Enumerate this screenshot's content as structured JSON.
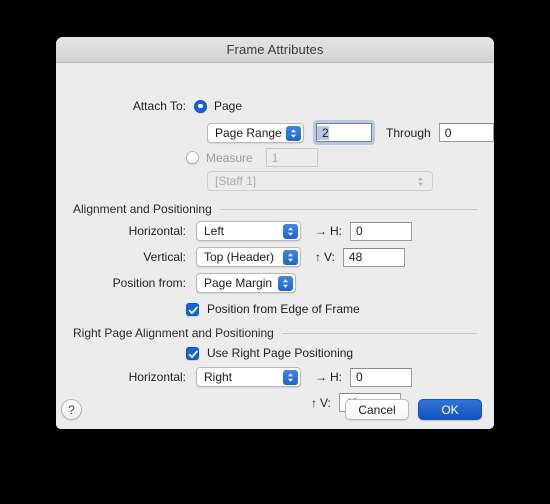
{
  "window": {
    "title": "Frame Attributes"
  },
  "attach": {
    "label": "Attach To:",
    "page_option": "Page",
    "page_selected": true,
    "range_popup": "Page Range",
    "range_value": "2",
    "through_label": "Through",
    "through_value": "0",
    "measure_option": "Measure",
    "measure_selected": false,
    "measure_value": "1",
    "staff_popup": "[Staff 1]"
  },
  "alignment": {
    "group_title": "Alignment and Positioning",
    "horizontal_label": "Horizontal:",
    "horizontal_value": "Left",
    "h_axis_glyph": "→",
    "h_axis_label": "H:",
    "h_value": "0",
    "vertical_label": "Vertical:",
    "vertical_value": "Top (Header)",
    "v_axis_glyph": "↑",
    "v_axis_label": "V:",
    "v_value": "48",
    "position_from_label": "Position from:",
    "position_from_value": "Page Margin",
    "edge_checkbox_label": "Position from Edge of Frame",
    "edge_checkbox_checked": true
  },
  "right_page": {
    "group_title": "Right Page Alignment and Positioning",
    "use_checkbox_label": "Use Right Page Positioning",
    "use_checkbox_checked": true,
    "horizontal_label": "Horizontal:",
    "horizontal_value": "Right",
    "h_axis_glyph": "→",
    "h_axis_label": "H:",
    "h_value": "0",
    "v_axis_glyph": "↑",
    "v_axis_label": "V:",
    "v_value": "48"
  },
  "footer": {
    "help_glyph": "?",
    "cancel_label": "Cancel",
    "ok_label": "OK"
  },
  "colors": {
    "accent_blue": "#1565d8",
    "ok_button_blue": "#1355c0",
    "window_bg": "#ececec",
    "titlebar_bg": "#d7d7d7"
  }
}
